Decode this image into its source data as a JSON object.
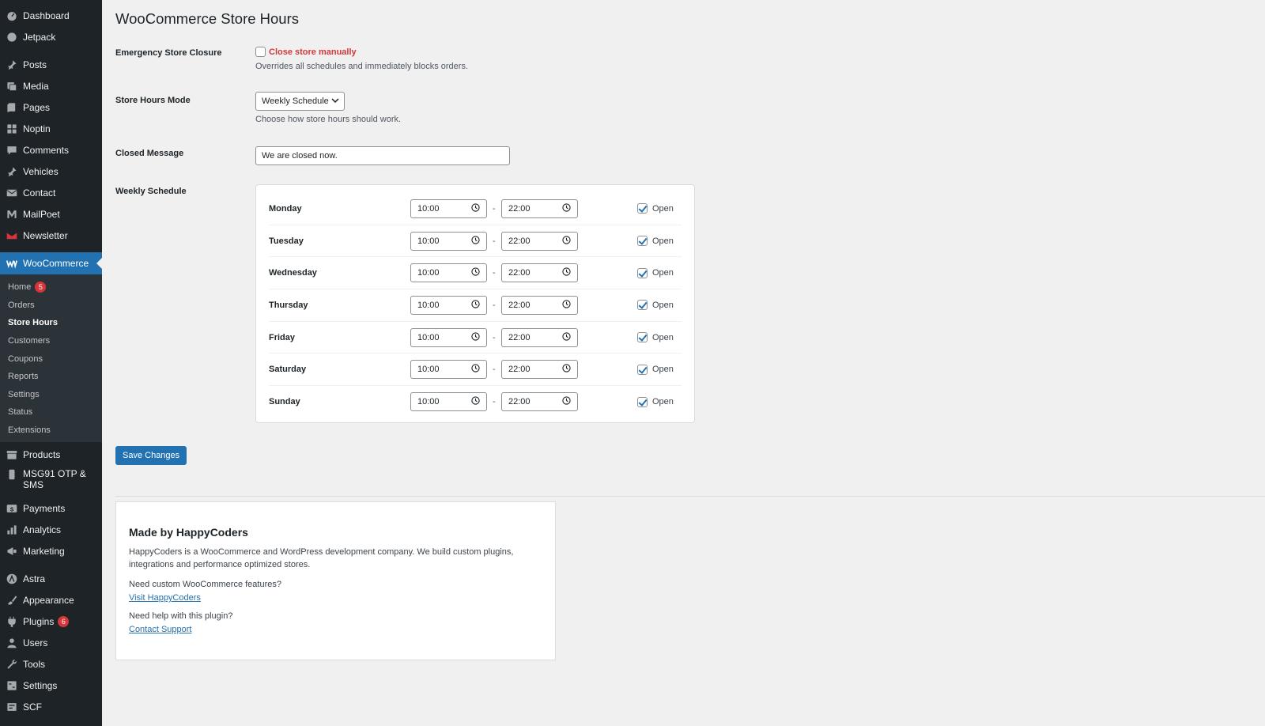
{
  "sidebar": {
    "top_items": [
      {
        "label": "Dashboard",
        "icon": "dashboard-icon"
      },
      {
        "label": "Jetpack",
        "icon": "jetpack-icon"
      }
    ],
    "items_a": [
      {
        "label": "Posts",
        "icon": "pin-icon"
      },
      {
        "label": "Media",
        "icon": "media-icon"
      },
      {
        "label": "Pages",
        "icon": "pages-icon"
      },
      {
        "label": "Noptin",
        "icon": "grid-icon"
      },
      {
        "label": "Comments",
        "icon": "comment-icon"
      },
      {
        "label": "Vehicles",
        "icon": "pin-icon"
      },
      {
        "label": "Contact",
        "icon": "mail-icon"
      },
      {
        "label": "MailPoet",
        "icon": "mailpoet-icon"
      },
      {
        "label": "Newsletter",
        "icon": "newsletter-icon"
      }
    ],
    "woocommerce": {
      "label": "WooCommerce",
      "icon": "woocommerce-icon"
    },
    "submenu": [
      {
        "label": "Home",
        "badge": "5"
      },
      {
        "label": "Orders"
      },
      {
        "label": "Store Hours",
        "current": true
      },
      {
        "label": "Customers"
      },
      {
        "label": "Coupons"
      },
      {
        "label": "Reports"
      },
      {
        "label": "Settings"
      },
      {
        "label": "Status"
      },
      {
        "label": "Extensions"
      }
    ],
    "items_b": [
      {
        "label": "Products",
        "icon": "archive-icon"
      },
      {
        "label": "MSG91 OTP & SMS",
        "icon": "phone-icon"
      },
      {
        "label": "Payments",
        "icon": "dollar-icon"
      },
      {
        "label": "Analytics",
        "icon": "bar-chart-icon"
      },
      {
        "label": "Marketing",
        "icon": "megaphone-icon"
      }
    ],
    "items_c": [
      {
        "label": "Astra",
        "icon": "astra-icon"
      },
      {
        "label": "Appearance",
        "icon": "brush-icon"
      },
      {
        "label": "Plugins",
        "icon": "plugin-icon",
        "badge": "6"
      },
      {
        "label": "Users",
        "icon": "user-icon"
      },
      {
        "label": "Tools",
        "icon": "wrench-icon"
      },
      {
        "label": "Settings",
        "icon": "settings-icon"
      },
      {
        "label": "SCF",
        "icon": "scf-icon"
      }
    ]
  },
  "page": {
    "title": "WooCommerce Store Hours",
    "emergency": {
      "label": "Emergency Store Closure",
      "checkbox_label": "Close store manually",
      "checked": false,
      "description": "Overrides all schedules and immediately blocks orders."
    },
    "mode": {
      "label": "Store Hours Mode",
      "selected": "Weekly Schedule",
      "description": "Choose how store hours should work."
    },
    "closed_message": {
      "label": "Closed Message",
      "value": "We are closed now."
    },
    "weekly": {
      "label": "Weekly Schedule",
      "separator": "-",
      "open_label": "Open",
      "days": [
        {
          "day": "Monday",
          "open": "10:00",
          "close": "22:00",
          "is_open": true
        },
        {
          "day": "Tuesday",
          "open": "10:00",
          "close": "22:00",
          "is_open": true
        },
        {
          "day": "Wednesday",
          "open": "10:00",
          "close": "22:00",
          "is_open": true
        },
        {
          "day": "Thursday",
          "open": "10:00",
          "close": "22:00",
          "is_open": true
        },
        {
          "day": "Friday",
          "open": "10:00",
          "close": "22:00",
          "is_open": true
        },
        {
          "day": "Saturday",
          "open": "10:00",
          "close": "22:00",
          "is_open": true
        },
        {
          "day": "Sunday",
          "open": "10:00",
          "close": "22:00",
          "is_open": true
        }
      ]
    },
    "save_label": "Save Changes"
  },
  "card": {
    "title": "Made by HappyCoders",
    "intro": "HappyCoders is a WooCommerce and WordPress development company. We build custom plugins, integrations and performance optimized stores.",
    "custom_q": "Need custom WooCommerce features?",
    "custom_link": "Visit HappyCoders",
    "help_q": "Need help with this plugin?",
    "help_link": "Contact Support"
  },
  "colors": {
    "sidebar_bg": "#1d2327",
    "accent": "#2271b1",
    "danger": "#d63638",
    "page_bg": "#f0f0f1"
  }
}
